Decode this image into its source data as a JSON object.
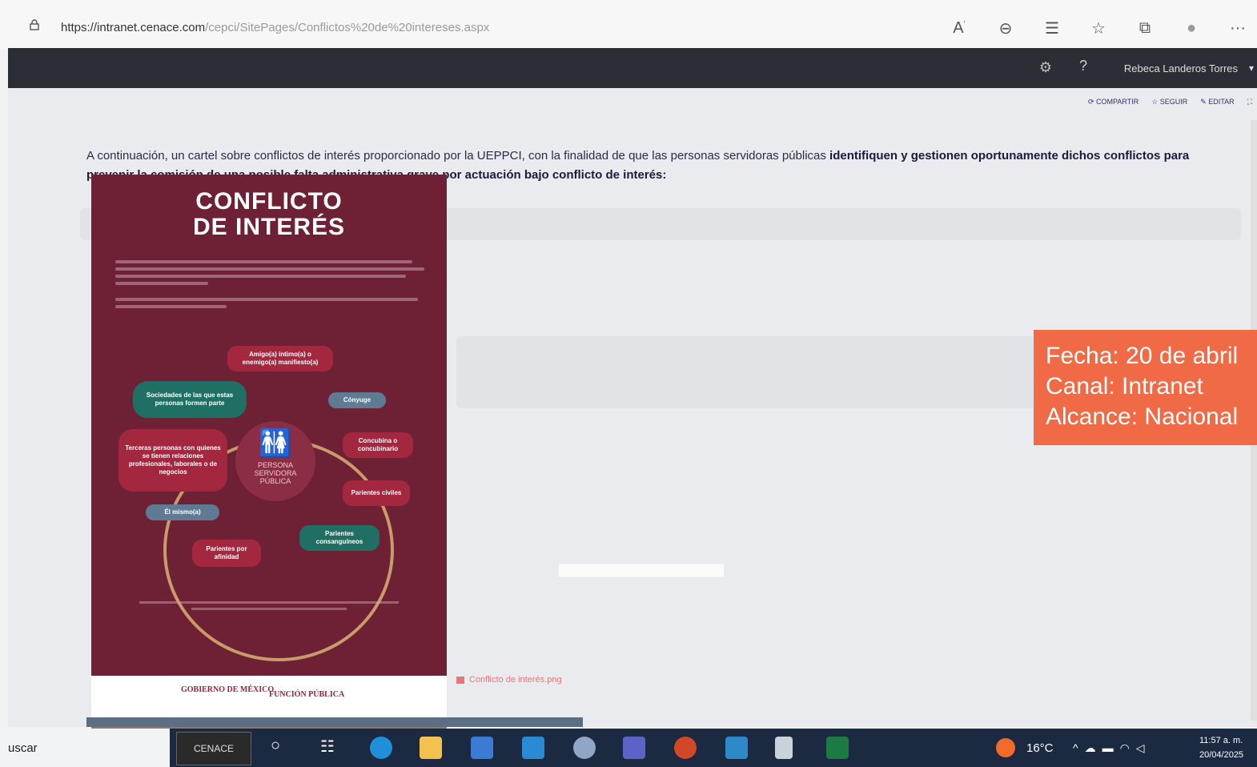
{
  "browser": {
    "url_domain": "https://intranet.cenace.com",
    "url_path": "/cepci/SitePages/Conflictos%20de%20intereses.aspx",
    "icons": [
      "read-aloud-icon",
      "zoom-icon",
      "reading-view-icon",
      "favorite-icon",
      "collections-icon",
      "profile-icon",
      "more-icon"
    ],
    "more_label": "···"
  },
  "header": {
    "help_label": "?",
    "user_name": "Rebeca Landeros Torres",
    "caret": "▾"
  },
  "page_actions": {
    "share": "COMPARTIR",
    "follow": "SEGUIR",
    "edit": "EDITAR"
  },
  "intro": {
    "text_regular": "A continuación, un cartel sobre conflictos de interés proporcionado por la UEPPCI, con la finalidad de que las personas servidoras públicas ",
    "text_bold": "identifiquen y gestionen oportunamente dichos conflictos para prevenir la comisión de una posible falta administrativa grave por actuación bajo conflicto de interés:"
  },
  "poster": {
    "title_line1": "CONFLICTO",
    "title_line2": "DE INTERÉS",
    "center_label": "PERSONA SERVIDORA PÚBLICA",
    "items": [
      "Amigo(a) íntimo(a) o enemigo(a) manifiesto(a)",
      "Cónyuge",
      "Concubina o concubinario",
      "Parientes civiles",
      "Parientes consanguíneos",
      "Parientes por afinidad",
      "Él mismo(a)",
      "Terceras personas con quienes se tienen relaciones profesionales, laborales o de negocios",
      "Sociedades de las que estas personas formen parte"
    ],
    "footer_logo_1": "GOBIERNO DE MÉXICO",
    "footer_logo_2": "FUNCIÓN PÚBLICA"
  },
  "file_link": "Conflicto de interés.png",
  "stamp": {
    "line1": "Fecha: 20 de abril",
    "line2": "Canal: Intranet",
    "line3": "Alcance: Nacional"
  },
  "taskbar": {
    "search_label": "uscar",
    "cenace_label": "CENACE",
    "weather": "16°C",
    "time": "11:57 a. m.",
    "date": "20/04/2025"
  }
}
